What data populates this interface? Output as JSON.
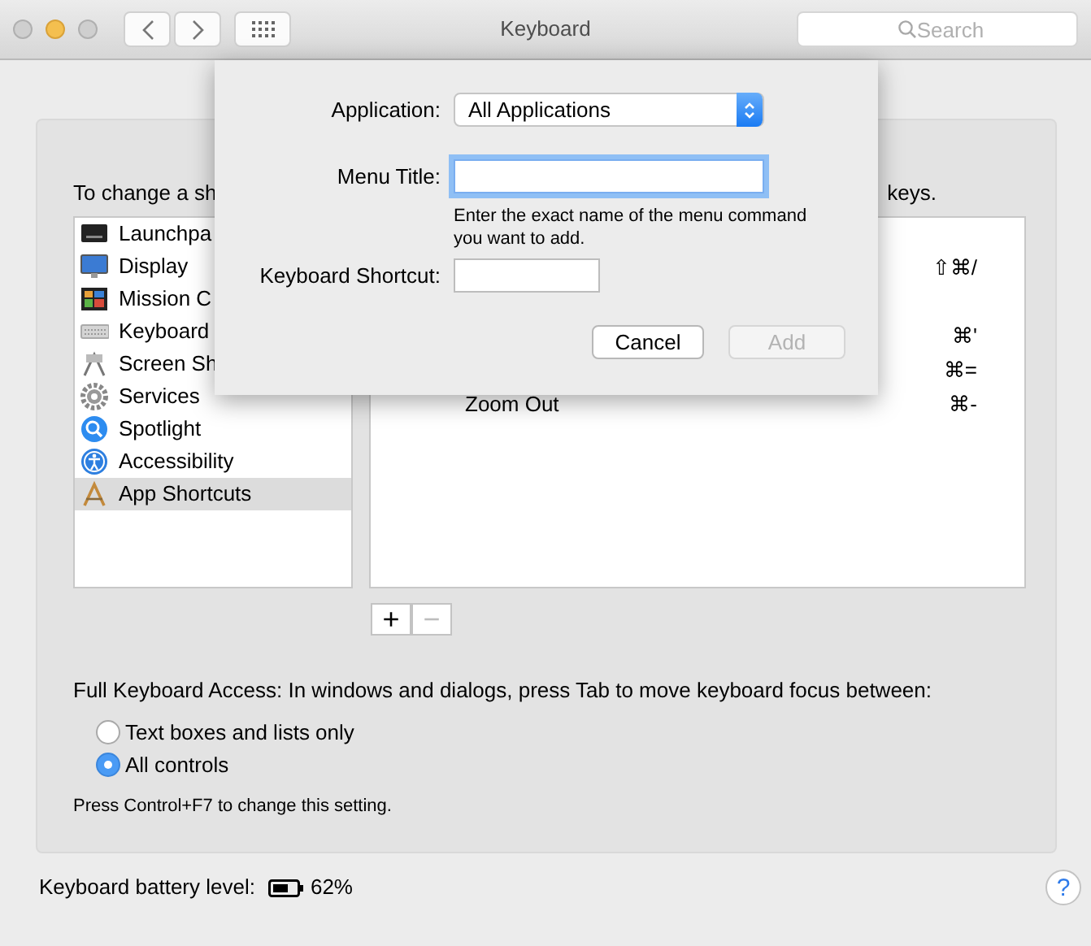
{
  "window": {
    "title": "Keyboard",
    "search_placeholder": "Search"
  },
  "instruction": {
    "start": "To change a sh",
    "end": "keys."
  },
  "categories": [
    {
      "label": "Launchpa",
      "selected": false
    },
    {
      "label": "Display",
      "selected": false
    },
    {
      "label": "Mission C",
      "selected": false
    },
    {
      "label": "Keyboard",
      "selected": false
    },
    {
      "label": "Screen Sh",
      "selected": false
    },
    {
      "label": "Services",
      "selected": false
    },
    {
      "label": "Spotlight",
      "selected": false
    },
    {
      "label": "Accessibility",
      "selected": false
    },
    {
      "label": "App Shortcuts",
      "selected": true
    }
  ],
  "shortcuts": [
    {
      "shortcut": "⇧⌘/"
    },
    {
      "shortcut": "⌘'"
    },
    {
      "shortcut": "⌘="
    },
    {
      "name": "Zoom Out",
      "shortcut": "⌘-"
    }
  ],
  "list_buttons": [
    {
      "label": "+",
      "disabled": false
    },
    {
      "label": "−",
      "disabled": true
    }
  ],
  "keyboard_access": {
    "text": "Full Keyboard Access: In windows and dialogs, press Tab to move keyboard focus between:",
    "options": [
      {
        "label": "Text boxes and lists only",
        "selected": false
      },
      {
        "label": "All controls",
        "selected": true
      }
    ],
    "note": "Press Control+F7 to change this setting."
  },
  "battery": {
    "label": "Keyboard battery level:",
    "value": "62%"
  },
  "help": "?",
  "sheet": {
    "application_label": "Application:",
    "application_value": "All Applications",
    "menu_title_label": "Menu Title:",
    "menu_title_focused": true,
    "hint": "Enter the exact name of the menu command you want to add.",
    "shortcut_label": "Keyboard Shortcut:",
    "buttons": [
      {
        "label": "Cancel",
        "disabled": false
      },
      {
        "label": "Add",
        "disabled": true
      }
    ]
  }
}
